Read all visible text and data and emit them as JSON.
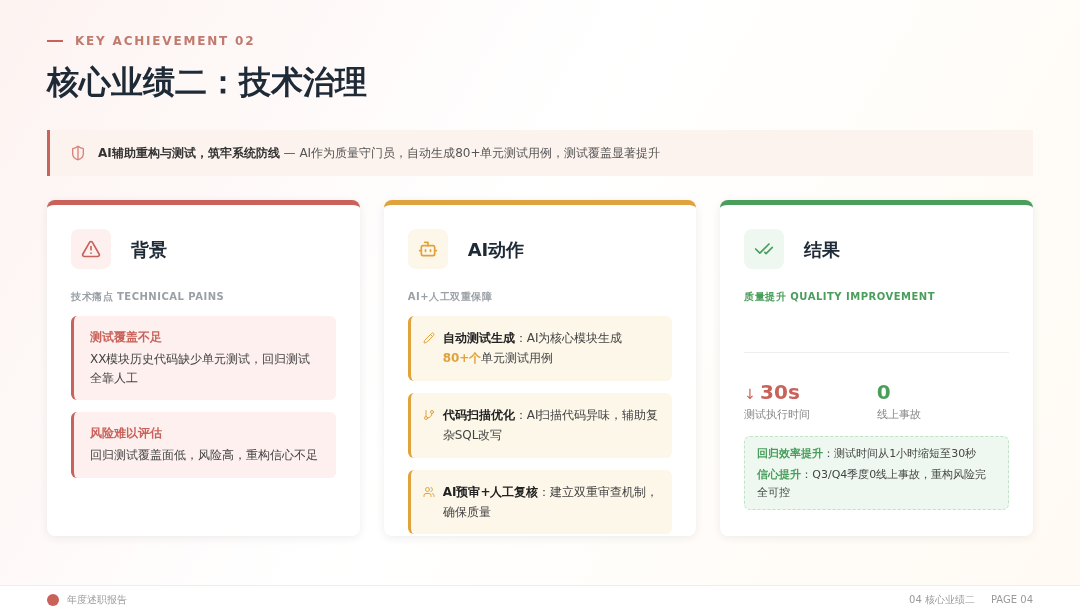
{
  "header": {
    "eyebrow": "KEY ACHIEVEMENT 02",
    "title": "核心业绩二：技术治理"
  },
  "banner": {
    "lead": "AI辅助重构与测试，筑牢系统防线",
    "text": " — AI作为质量守门员，自动生成80+单元测试用例，测试覆盖显著提升"
  },
  "cards": [
    {
      "kind": "pains",
      "color": "#c9625a",
      "title": "背景",
      "subtitle": "技术痛点 TECHNICAL PAINS",
      "items": [
        {
          "title": "测试覆盖不足",
          "text": "XX模块历史代码缺少单元测试，回归测试全靠人工"
        },
        {
          "title": "风险难以评估",
          "text": "回归测试覆盖面低，风险高，重构信心不足"
        }
      ]
    },
    {
      "kind": "actions",
      "color": "#e0a23c",
      "title": "AI动作",
      "subtitle": "AI+人工双重保障",
      "items": [
        {
          "label": "自动测试生成",
          "text": "：AI为核心模块生成",
          "highlight": "80+个",
          "text_after": "单元测试用例"
        },
        {
          "label": "代码扫描优化",
          "text": "：AI扫描代码异味，辅助复杂SQL改写"
        },
        {
          "label": "AI预审+人工复核",
          "text": "：建立双重审查机制，确保质量"
        }
      ]
    },
    {
      "kind": "results",
      "color": "#4a9e5c",
      "title": "结果",
      "subtitle": "质量提升 QUALITY IMPROVEMENT",
      "stats": [
        {
          "arrow": "↓",
          "value": "30s",
          "label": "测试执行时间",
          "color": "#c9625a"
        },
        {
          "value": "0",
          "label": "线上事故",
          "color": "#4a9e5c"
        }
      ],
      "notes": [
        {
          "label": "回归效率提升",
          "text": "：测试时间从1小时缩短至30秒"
        },
        {
          "label": "信心提升",
          "text": "：Q3/Q4季度0线上事故，重构风险完全可控"
        }
      ]
    }
  ],
  "footer": {
    "left": "年度述职报告",
    "section": "04 核心业绩二",
    "page": "PAGE 04"
  }
}
